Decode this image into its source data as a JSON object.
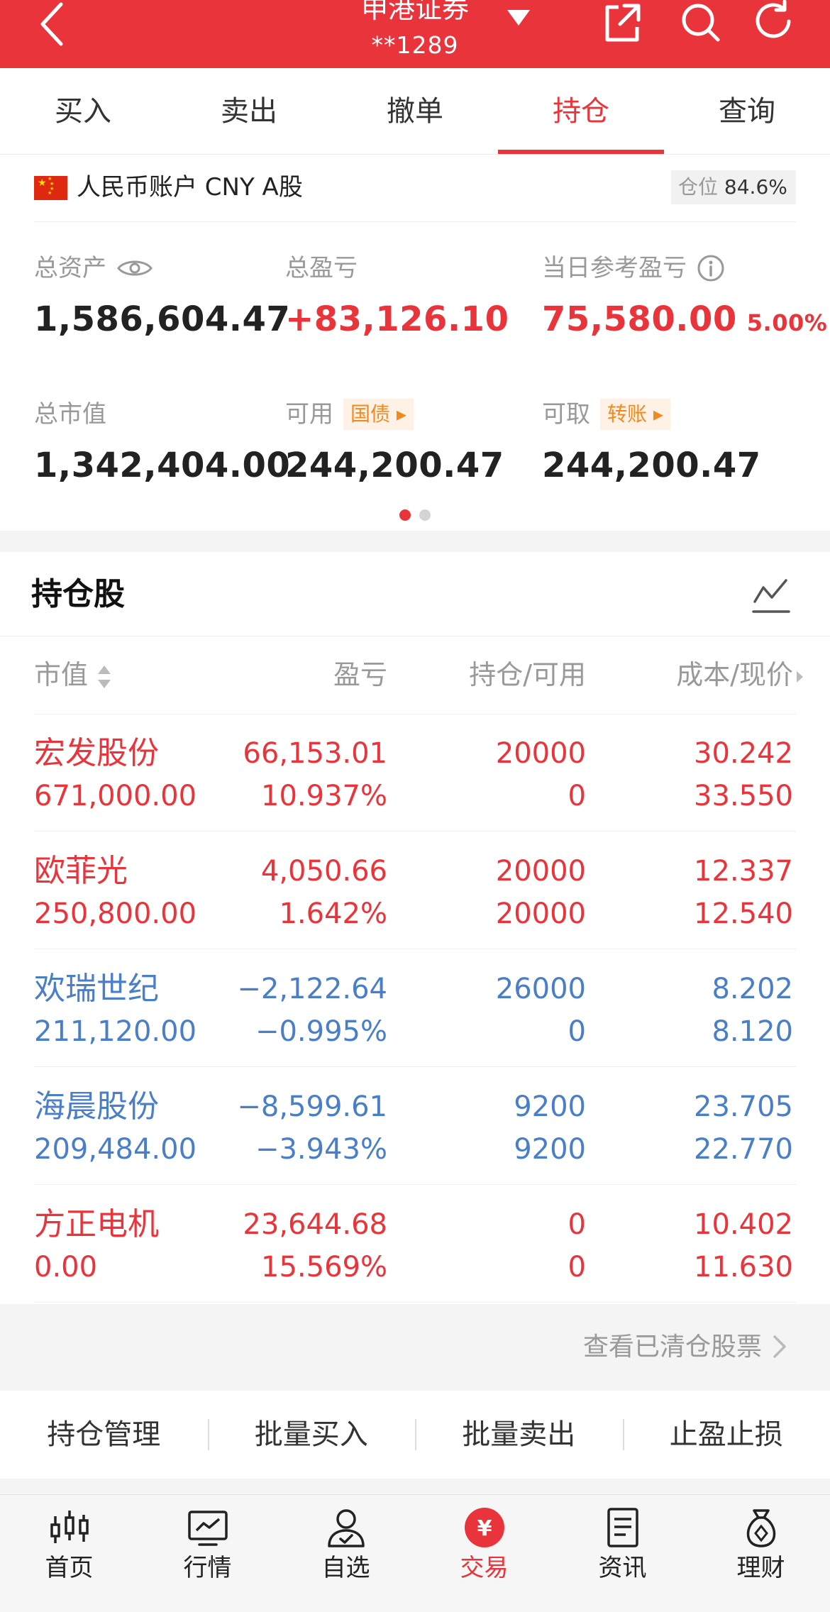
{
  "header": {
    "broker": "申港证券",
    "account": "**1289",
    "icons": [
      "back-icon",
      "dropdown-icon",
      "share-icon",
      "search-icon",
      "refresh-icon"
    ]
  },
  "tabs": [
    {
      "label": "买入"
    },
    {
      "label": "卖出"
    },
    {
      "label": "撤单"
    },
    {
      "label": "持仓",
      "active": true
    },
    {
      "label": "查询"
    }
  ],
  "account": {
    "currency_label": "人民币账户 CNY A股",
    "position_label": "仓位",
    "position_value": "84.6%",
    "total_assets_label": "总资产",
    "total_assets": "1,586,604.47",
    "total_pl_label": "总盈亏",
    "total_pl": "+83,126.10",
    "daily_pl_label": "当日参考盈亏",
    "daily_pl": "75,580.00",
    "daily_pl_pct": "5.00%",
    "market_value_label": "总市值",
    "market_value": "1,342,404.00",
    "available_label": "可用",
    "available_tag": "国债",
    "available": "244,200.47",
    "withdrawable_label": "可取",
    "withdrawable_tag": "转账",
    "withdrawable": "244,200.47"
  },
  "holdings": {
    "title": "持仓股",
    "columns": [
      "市值",
      "盈亏",
      "持仓/可用",
      "成本/现价"
    ],
    "rows": [
      {
        "name": "宏发股份",
        "market_value": "671,000.00",
        "pl": "66,153.01",
        "pl_pct": "10.937%",
        "position": "20000",
        "available": "0",
        "cost": "30.242",
        "price": "33.550",
        "trend": "up"
      },
      {
        "name": "欧菲光",
        "market_value": "250,800.00",
        "pl": "4,050.66",
        "pl_pct": "1.642%",
        "position": "20000",
        "available": "20000",
        "cost": "12.337",
        "price": "12.540",
        "trend": "up"
      },
      {
        "name": "欢瑞世纪",
        "market_value": "211,120.00",
        "pl": "−2,122.64",
        "pl_pct": "−0.995%",
        "position": "26000",
        "available": "0",
        "cost": "8.202",
        "price": "8.120",
        "trend": "down"
      },
      {
        "name": "海晨股份",
        "market_value": "209,484.00",
        "pl": "−8,599.61",
        "pl_pct": "−3.943%",
        "position": "9200",
        "available": "9200",
        "cost": "23.705",
        "price": "22.770",
        "trend": "down"
      },
      {
        "name": "方正电机",
        "market_value": "0.00",
        "pl": "23,644.68",
        "pl_pct": "15.569%",
        "position": "0",
        "available": "0",
        "cost": "10.402",
        "price": "11.630",
        "trend": "up"
      }
    ],
    "view_cleared": "查看已清仓股票"
  },
  "bulk_actions": [
    "持仓管理",
    "批量买入",
    "批量卖出",
    "止盈止损"
  ],
  "nav": [
    {
      "label": "首页",
      "icon": "candlestick-icon"
    },
    {
      "label": "行情",
      "icon": "market-chart-icon"
    },
    {
      "label": "自选",
      "icon": "user-star-icon"
    },
    {
      "label": "交易",
      "icon": "yuan-icon",
      "active": true
    },
    {
      "label": "资讯",
      "icon": "news-icon"
    },
    {
      "label": "理财",
      "icon": "money-bag-icon"
    }
  ],
  "colors": {
    "brand_red": "#e8343a",
    "loss_blue": "#4a7ec7",
    "tag_orange": "#f08a1e"
  }
}
